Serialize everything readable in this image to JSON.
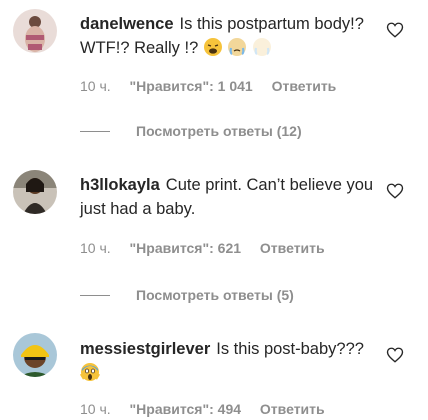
{
  "comments": [
    {
      "username": "danelwence",
      "text": "Is this postpartum body!? WTF!? Really !?",
      "time": "10 ч.",
      "likes": "\"Нравится\": 1 041",
      "reply": "Ответить",
      "view_replies": "Посмотреть ответы (12)",
      "emojis": [
        "weary-face-emoji",
        "crying-face-emoji",
        "crying-face-emoji"
      ]
    },
    {
      "username": "h3llokayla",
      "text": "Cute print. Can’t believe you just had a baby.",
      "time": "10 ч.",
      "likes": "\"Нравится\": 621",
      "reply": "Ответить",
      "view_replies": "Посмотреть ответы (5)"
    },
    {
      "username": "messiestgirlever",
      "text": "Is this post-baby???",
      "time": "10 ч.",
      "likes": "\"Нравится\": 494",
      "reply": "Ответить",
      "emojis": [
        "screaming-face-emoji"
      ]
    }
  ],
  "colors": {
    "text": "#262626",
    "secondary": "#8e8e8e",
    "background": "#ffffff"
  }
}
